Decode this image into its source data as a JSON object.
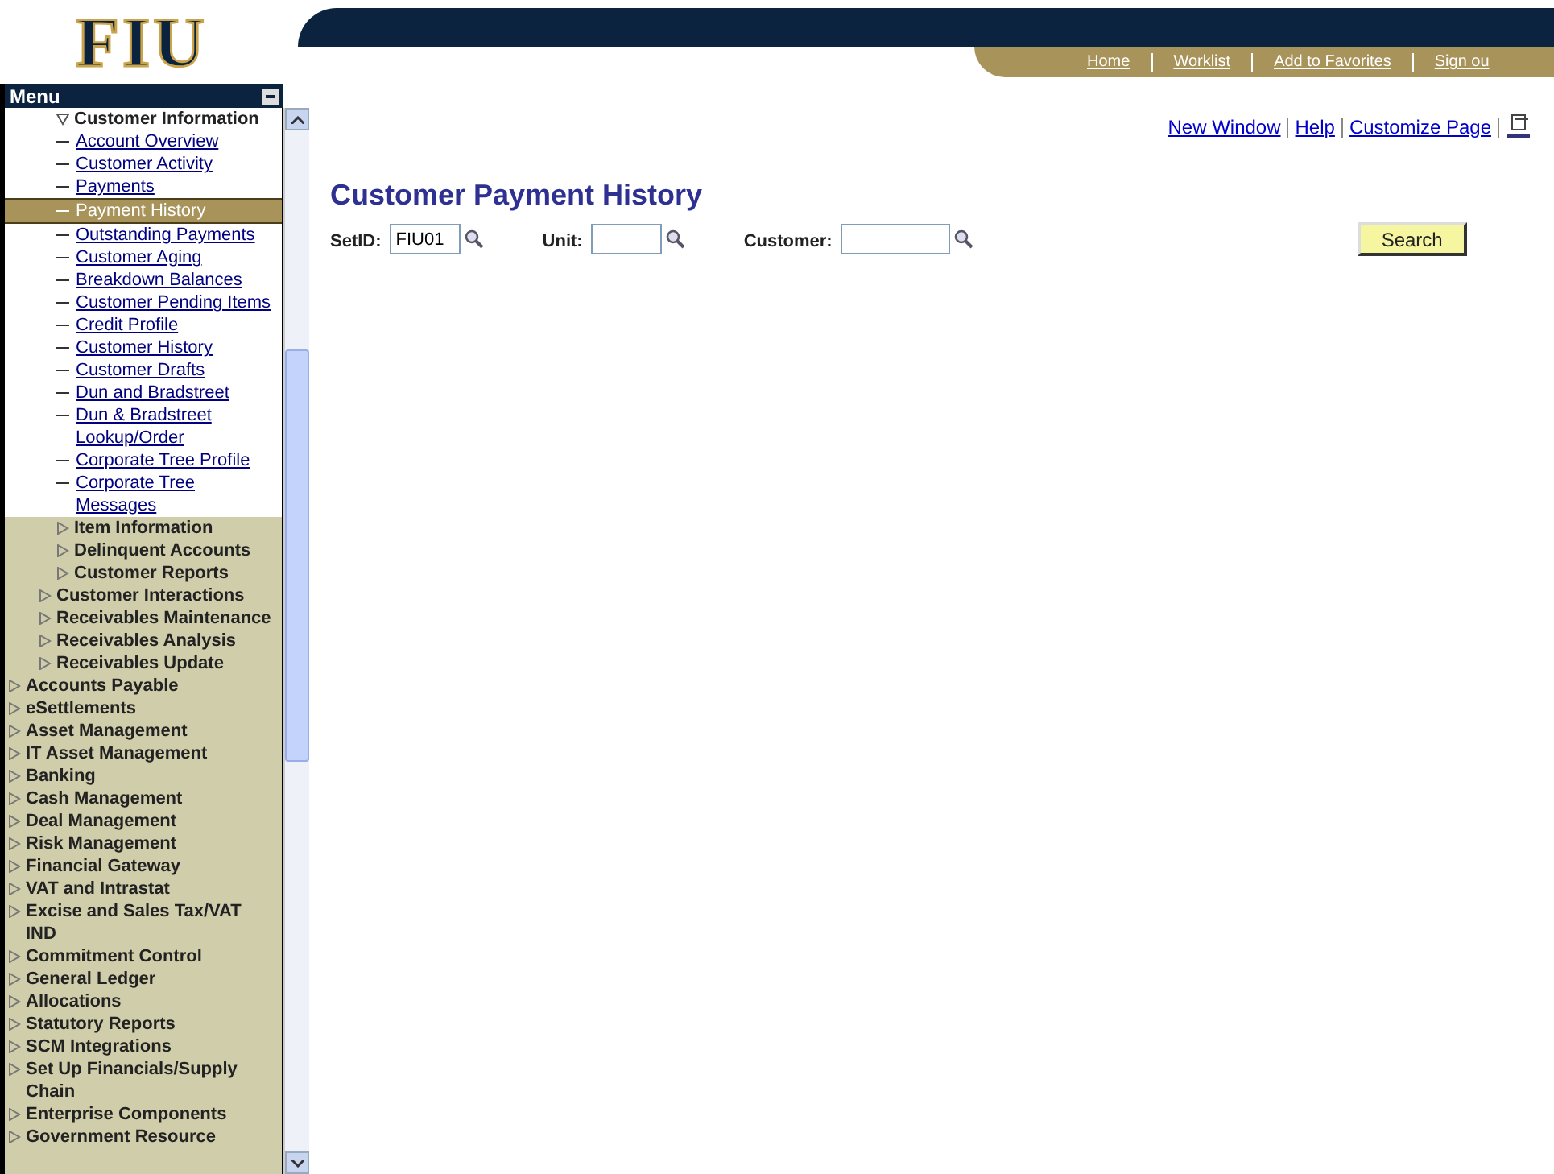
{
  "logo": {
    "text": "FIU"
  },
  "header": {
    "links": [
      "Home",
      "Worklist",
      "Add to Favorites",
      "Sign ou"
    ]
  },
  "menu": {
    "title": "Menu",
    "tree": [
      {
        "children": [
          {
            "children": [
              {
                "label": "Customer Information",
                "expanded": true,
                "children": [
                  {
                    "label": "Account Overview",
                    "selected": false
                  },
                  {
                    "label": "Customer Activity",
                    "selected": false
                  },
                  {
                    "label": "Payments",
                    "selected": false
                  },
                  {
                    "label": "Payment History",
                    "selected": true
                  },
                  {
                    "label": "Outstanding Payments",
                    "selected": false
                  },
                  {
                    "label": "Customer Aging",
                    "selected": false
                  },
                  {
                    "label": "Breakdown Balances",
                    "selected": false
                  },
                  {
                    "label": "Customer Pending Items",
                    "selected": false
                  },
                  {
                    "label": "Credit Profile",
                    "selected": false
                  },
                  {
                    "label": "Customer History",
                    "selected": false
                  },
                  {
                    "label": "Customer Drafts",
                    "selected": false
                  },
                  {
                    "label": "Dun and Bradstreet",
                    "selected": false
                  },
                  {
                    "label": "Dun & Bradstreet Lookup/Order",
                    "selected": false
                  },
                  {
                    "label": "Corporate Tree Profile",
                    "selected": false
                  },
                  {
                    "label": "Corporate Tree Messages",
                    "selected": false
                  }
                ]
              },
              {
                "label": "Item Information",
                "expanded": false
              },
              {
                "label": "Delinquent Accounts",
                "expanded": false
              },
              {
                "label": "Customer Reports",
                "expanded": false
              }
            ]
          },
          {
            "label": "Customer Interactions",
            "expanded": false
          },
          {
            "label": "Receivables Maintenance",
            "expanded": false
          },
          {
            "label": "Receivables Analysis",
            "expanded": false
          },
          {
            "label": "Receivables Update",
            "expanded": false
          }
        ]
      },
      {
        "label": "Accounts Payable",
        "expanded": false
      },
      {
        "label": "eSettlements",
        "expanded": false
      },
      {
        "label": "Asset Management",
        "expanded": false
      },
      {
        "label": "IT Asset Management",
        "expanded": false
      },
      {
        "label": "Banking",
        "expanded": false
      },
      {
        "label": "Cash Management",
        "expanded": false
      },
      {
        "label": "Deal Management",
        "expanded": false
      },
      {
        "label": "Risk Management",
        "expanded": false
      },
      {
        "label": "Financial Gateway",
        "expanded": false
      },
      {
        "label": "VAT and Intrastat",
        "expanded": false
      },
      {
        "label": "Excise and Sales Tax/VAT IND",
        "expanded": false
      },
      {
        "label": "Commitment Control",
        "expanded": false
      },
      {
        "label": "General Ledger",
        "expanded": false
      },
      {
        "label": "Allocations",
        "expanded": false
      },
      {
        "label": "Statutory Reports",
        "expanded": false
      },
      {
        "label": "SCM Integrations",
        "expanded": false
      },
      {
        "label": "Set Up Financials/Supply Chain",
        "expanded": false
      },
      {
        "label": "Enterprise Components",
        "expanded": false
      },
      {
        "label": "Government Resource",
        "expanded": false
      }
    ]
  },
  "page_links": [
    "New Window",
    "Help",
    "Customize Page"
  ],
  "title": "Customer Payment History",
  "form": {
    "fields": [
      {
        "label": "SetID:",
        "value": "FIU01"
      },
      {
        "label": "Unit:"
      },
      {
        "label": "Customer:"
      }
    ],
    "button": "Search"
  }
}
